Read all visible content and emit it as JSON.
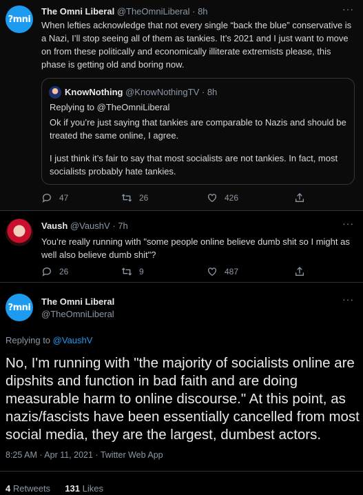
{
  "tweet1": {
    "avatar_text": "?mni",
    "name": "The Omni Liberal",
    "handle": "@TheOmniLiberal",
    "time": "· 8h",
    "more": "···",
    "text": "When lefties acknowledge that not every single “back the blue” conservative is a Nazi, I’ll stop seeing all of them as tankies. It’s 2021 and I just want to move on from these politically and economically illiterate extremists please, this phase is getting old and boring now.",
    "quote": {
      "name": "KnowNothing",
      "handle": "@KnowNothingTV",
      "time": "· 8h",
      "replying": "Replying to @TheOmniLiberal",
      "p1": "Ok if you’re just saying that tankies are comparable to Nazis and should be treated the same online, I agree.",
      "p2": "I just think it’s fair to say that most socialists are not tankies. In fact, most socialists probably hate tankies."
    },
    "replies": "47",
    "retweets": "26",
    "likes": "426"
  },
  "tweet2": {
    "name": "Vaush",
    "handle": "@VaushV",
    "time": "· 7h",
    "more": "···",
    "text": "You’re really running with \"some people online believe dumb shit so I might as well also believe dumb shit\"?",
    "replies": "26",
    "retweets": "9",
    "likes": "487"
  },
  "tweet3": {
    "avatar_text": "?mni",
    "name": "The Omni Liberal",
    "handle": "@TheOmniLiberal",
    "more": "···",
    "replying_prefix": "Replying to",
    "replying_to": "@VaushV",
    "text": "No, I'm running with \"the majority of socialists online are dipshits and function in bad faith and are doing measurable harm to online discourse.\" At this point, as nazis/fascists have been essentially cancelled from most social media, they are the largest, dumbest actors.",
    "meta": "8:25 AM · Apr 11, 2021 · Twitter Web App",
    "retweets_count": "4",
    "retweets_label": "Retweets",
    "likes_count": "131",
    "likes_label": "Likes"
  },
  "colors": {
    "accent": "#1d9bf0",
    "muted": "#8b98a5",
    "bg": "#000000"
  }
}
